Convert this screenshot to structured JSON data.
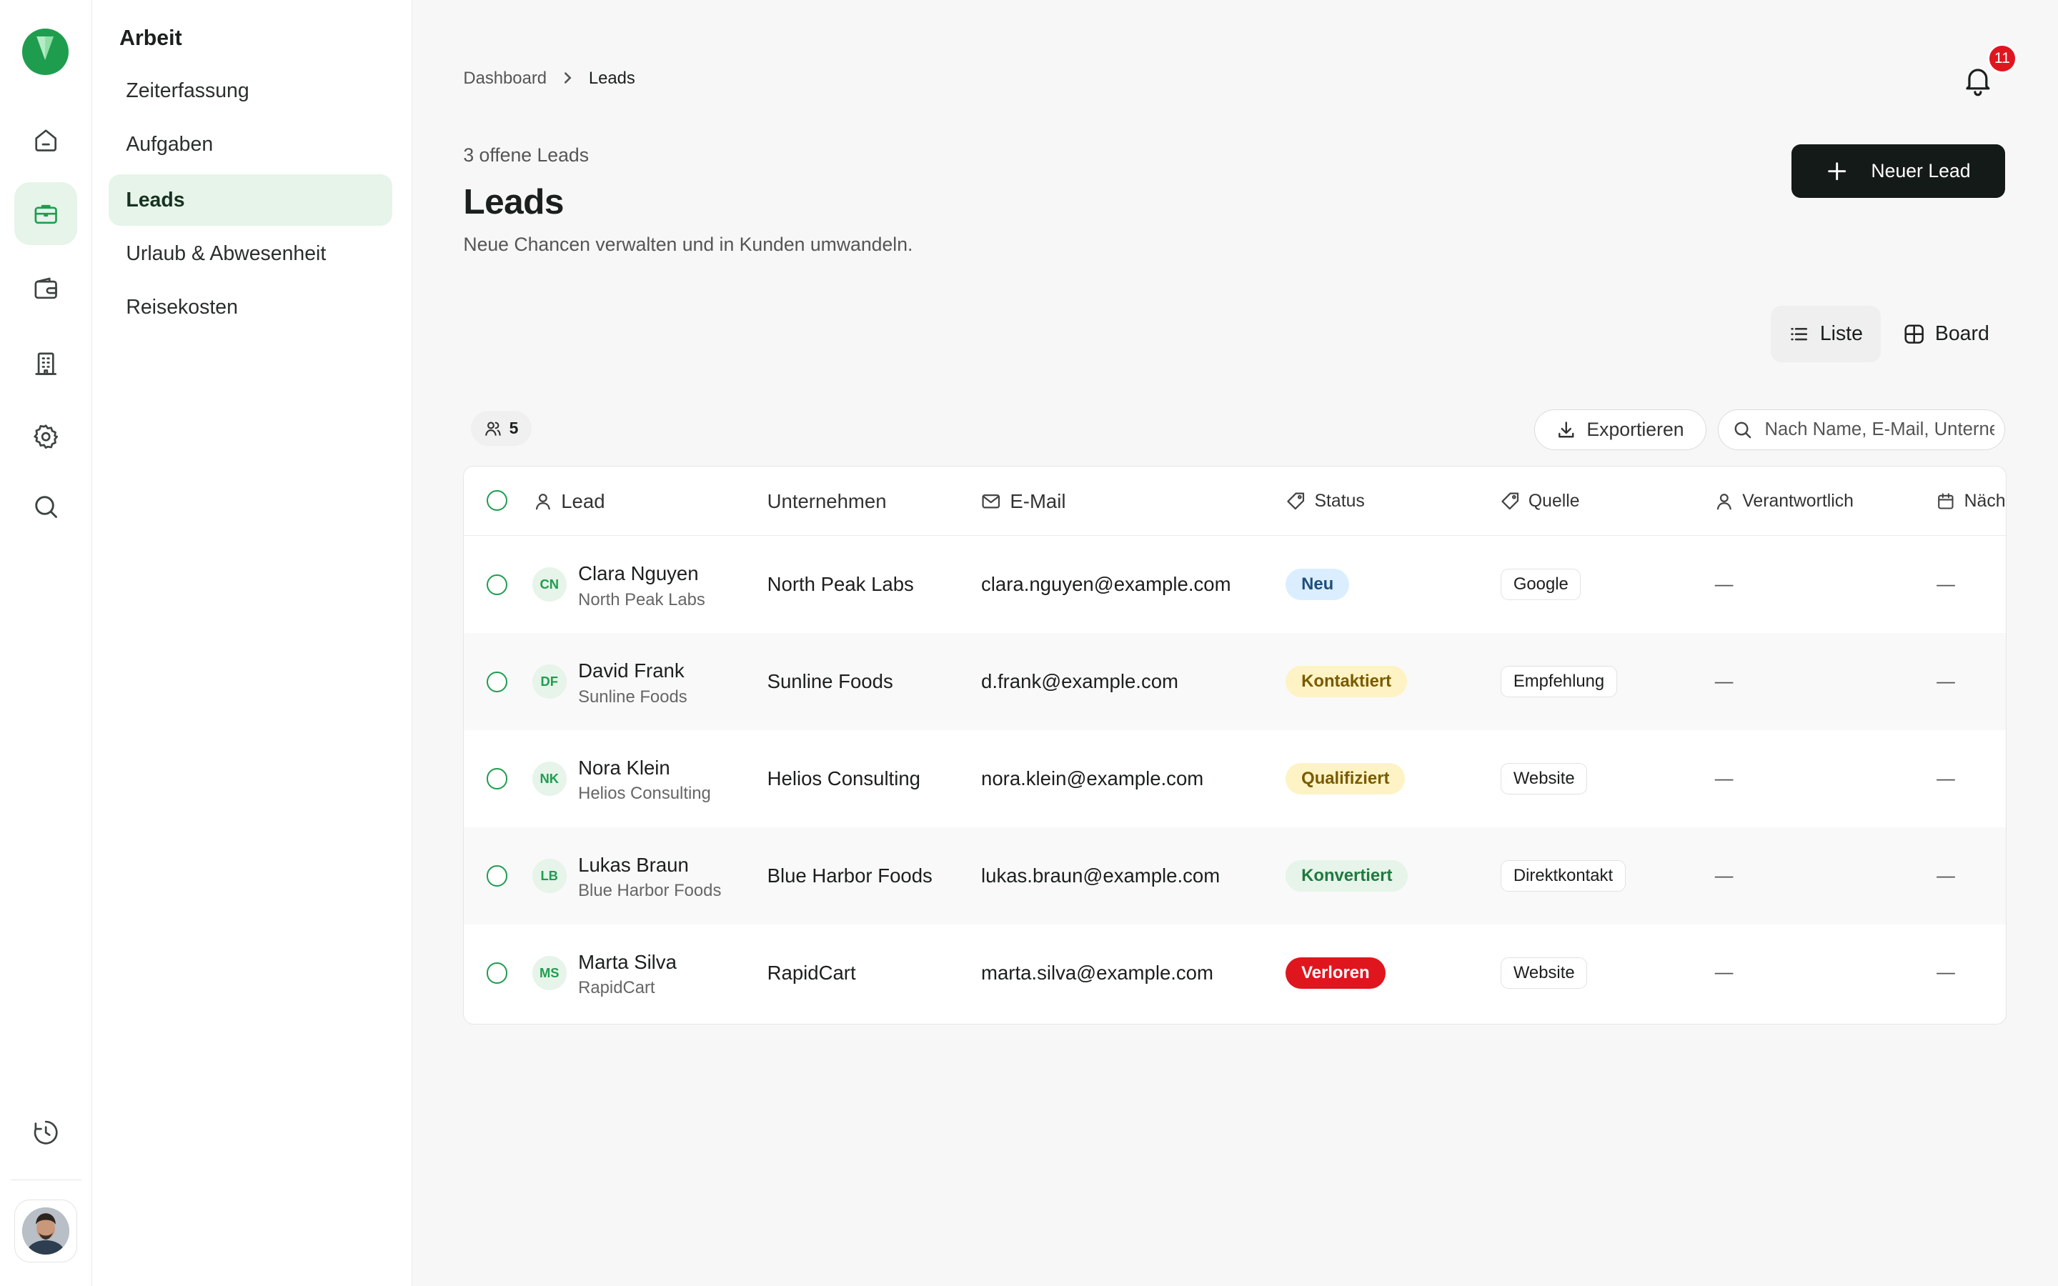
{
  "sidebar": {
    "title": "Arbeit",
    "items": [
      {
        "label": "Zeiterfassung"
      },
      {
        "label": "Aufgaben"
      },
      {
        "label": "Leads"
      },
      {
        "label": "Urlaub & Abwesenheit"
      },
      {
        "label": "Reisekosten"
      }
    ],
    "active_item": "Leads"
  },
  "rail": {
    "icons": [
      "home-icon",
      "briefcase-icon",
      "wallet-icon",
      "building-icon",
      "settings-icon",
      "search-icon",
      "history-icon"
    ],
    "active_icon": "briefcase-icon"
  },
  "breadcrumb": {
    "items": [
      "Dashboard",
      "Leads"
    ]
  },
  "notifications": {
    "count": "11"
  },
  "header": {
    "subtitle": "3 offene Leads",
    "title": "Leads",
    "description": "Neue Chancen verwalten und in Kunden umwandeln.",
    "new_button": "Neuer Lead"
  },
  "views": {
    "list": "Liste",
    "board": "Board",
    "active": "Liste"
  },
  "toolbar": {
    "count": "5",
    "export": "Exportieren",
    "search_placeholder": "Nach Name, E-Mail, Unternehmen suchen"
  },
  "table": {
    "columns": [
      "Lead",
      "Unternehmen",
      "E-Mail",
      "Status",
      "Quelle",
      "Verantwortlich",
      "Näch"
    ],
    "rows": [
      {
        "initials": "CN",
        "name": "Clara Nguyen",
        "company": "North Peak Labs",
        "email": "clara.nguyen@example.com",
        "status": "Neu",
        "source": "Google",
        "owner": "—",
        "next": "—"
      },
      {
        "initials": "DF",
        "name": "David Frank",
        "company": "Sunline Foods",
        "email": "d.frank@example.com",
        "status": "Kontaktiert",
        "source": "Empfehlung",
        "owner": "—",
        "next": "—"
      },
      {
        "initials": "NK",
        "name": "Nora Klein",
        "company": "Helios Consulting",
        "email": "nora.klein@example.com",
        "status": "Qualifiziert",
        "source": "Website",
        "owner": "—",
        "next": "—"
      },
      {
        "initials": "LB",
        "name": "Lukas Braun",
        "company": "Blue Harbor Foods",
        "email": "lukas.braun@example.com",
        "status": "Konvertiert",
        "source": "Direktkontakt",
        "owner": "—",
        "next": "—"
      },
      {
        "initials": "MS",
        "name": "Marta Silva",
        "company": "RapidCart",
        "email": "marta.silva@example.com",
        "status": "Verloren",
        "source": "Website",
        "owner": "—",
        "next": "—"
      }
    ]
  },
  "colors": {
    "brand_green": "#1f9d4f",
    "status_neu_bg": "#dbeeff",
    "status_neu_fg": "#1f4f7a",
    "status_kontaktiert_bg": "#fdf3c4",
    "status_kontaktiert_fg": "#7a5a00",
    "status_qualifiziert_bg": "#fdf3c4",
    "status_qualifiziert_fg": "#7a5a00",
    "status_konvertiert_bg": "#e6f4ea",
    "status_konvertiert_fg": "#1f7a3d",
    "status_verloren_bg": "#e0161f",
    "status_verloren_fg": "#ffffff"
  }
}
